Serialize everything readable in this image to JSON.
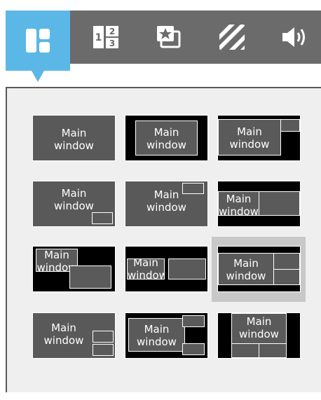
{
  "toolbar": {
    "tabs": [
      {
        "name": "layout-tab",
        "icon": "layout-grid-icon",
        "active": true
      },
      {
        "name": "numbered-tab",
        "icon": "numbered-grid-icon",
        "labels": [
          "1",
          "2",
          "3"
        ]
      },
      {
        "name": "star-window-tab",
        "icon": "star-window-icon"
      },
      {
        "name": "stripes-tab",
        "icon": "stripes-icon"
      },
      {
        "name": "audio-tab",
        "icon": "speaker-icon"
      }
    ],
    "active_color": "#5bb8e6",
    "bar_color": "#6b6b6b"
  },
  "layouts": {
    "main_label_1": "Main",
    "main_label_2": "window",
    "selected_index": 8,
    "count": 12
  }
}
